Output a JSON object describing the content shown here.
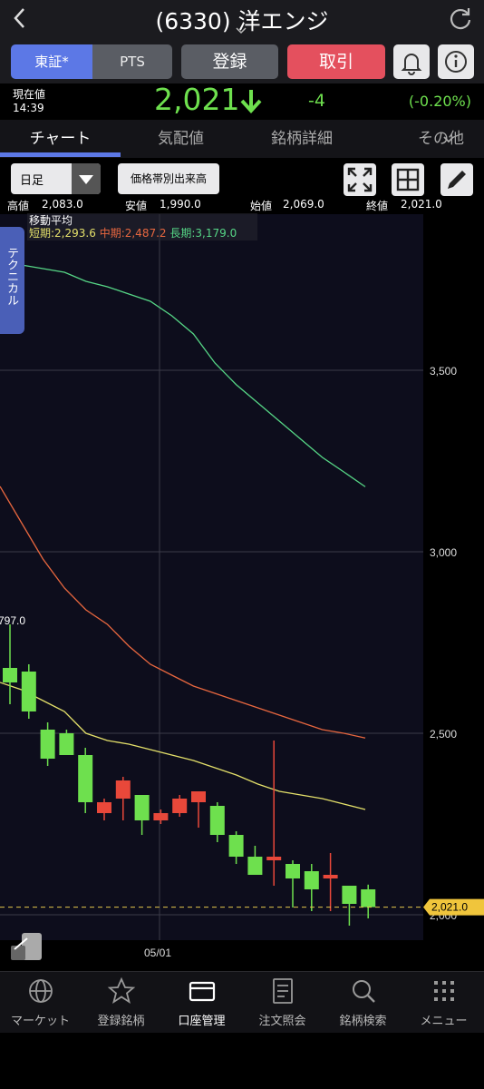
{
  "header": {
    "title": "(6330) 洋エンジ"
  },
  "buttons": {
    "tse": "東証*",
    "pts": "PTS",
    "register": "登録",
    "trade": "取引"
  },
  "price": {
    "label": "現在値",
    "time": "14:39",
    "value": "2,021",
    "change": "-4",
    "change_pct": "(-0.20%)"
  },
  "tabs": [
    {
      "label": "チャート"
    },
    {
      "label": "気配値"
    },
    {
      "label": "銘柄詳細"
    },
    {
      "label": "その他"
    }
  ],
  "toolbar": {
    "period": "日足",
    "volume_profile": "価格帯別出来高"
  },
  "ohlc": {
    "high_label": "高値",
    "high": "2,083.0",
    "low_label": "安値",
    "low": "1,990.0",
    "open_label": "始値",
    "open": "2,069.0",
    "close_label": "終値",
    "close": "2,021.0"
  },
  "moving_average": {
    "title": "移動平均",
    "short_label": "短期:2,293.6",
    "mid_label": "中期:2,487.2",
    "long_label": "長期:3,179.0",
    "colors": {
      "short": "#e4e06a",
      "mid": "#e8673f",
      "long": "#56d686"
    }
  },
  "technical_tab": "テクニカル",
  "chart_data": {
    "type": "candlestick",
    "y_ticks": [
      "3,500",
      "3,000",
      "2,500",
      "2,000"
    ],
    "ylim": [
      1930,
      3930
    ],
    "x_ticks": [
      "05/01"
    ],
    "visible_high_label": "797.0",
    "last_price_label": "2,021.0",
    "last_price": 2021,
    "candles": [
      {
        "o": 2680,
        "h": 2800,
        "l": 2580,
        "c": 2640
      },
      {
        "o": 2670,
        "h": 2690,
        "l": 2540,
        "c": 2560
      },
      {
        "o": 2510,
        "h": 2530,
        "l": 2410,
        "c": 2430
      },
      {
        "o": 2500,
        "h": 2510,
        "l": 2440,
        "c": 2440
      },
      {
        "o": 2440,
        "h": 2460,
        "l": 2280,
        "c": 2310
      },
      {
        "o": 2280,
        "h": 2320,
        "l": 2260,
        "c": 2310
      },
      {
        "o": 2320,
        "h": 2380,
        "l": 2260,
        "c": 2370
      },
      {
        "o": 2330,
        "h": 2330,
        "l": 2220,
        "c": 2260
      },
      {
        "o": 2260,
        "h": 2290,
        "l": 2250,
        "c": 2280
      },
      {
        "o": 2280,
        "h": 2330,
        "l": 2270,
        "c": 2320
      },
      {
        "o": 2310,
        "h": 2340,
        "l": 2240,
        "c": 2340
      },
      {
        "o": 2300,
        "h": 2310,
        "l": 2200,
        "c": 2220
      },
      {
        "o": 2220,
        "h": 2230,
        "l": 2140,
        "c": 2160
      },
      {
        "o": 2160,
        "h": 2190,
        "l": 2110,
        "c": 2110
      },
      {
        "o": 2150,
        "h": 2480,
        "l": 2080,
        "c": 2160
      },
      {
        "o": 2140,
        "h": 2150,
        "l": 2020,
        "c": 2100
      },
      {
        "o": 2120,
        "h": 2140,
        "l": 2010,
        "c": 2070
      },
      {
        "o": 2100,
        "h": 2170,
        "l": 2010,
        "c": 2110
      },
      {
        "o": 2080,
        "h": 2080,
        "l": 1970,
        "c": 2030
      },
      {
        "o": 2070,
        "h": 2083,
        "l": 1990,
        "c": 2021
      }
    ],
    "ma_short": [
      2640,
      2620,
      2590,
      2560,
      2500,
      2480,
      2470,
      2455,
      2440,
      2425,
      2405,
      2385,
      2360,
      2340,
      2330,
      2320,
      2305,
      2290
    ],
    "ma_mid": [
      3180,
      3080,
      2980,
      2900,
      2840,
      2800,
      2740,
      2690,
      2660,
      2630,
      2610,
      2590,
      2570,
      2550,
      2530,
      2510,
      2500,
      2487
    ],
    "ma_long": [
      3800,
      3790,
      3780,
      3770,
      3745,
      3730,
      3710,
      3690,
      3650,
      3600,
      3520,
      3460,
      3410,
      3360,
      3310,
      3260,
      3220,
      3179
    ]
  },
  "bottom_nav": [
    {
      "label": "マーケット",
      "icon": "globe-icon"
    },
    {
      "label": "登録銘柄",
      "icon": "star-icon"
    },
    {
      "label": "口座管理",
      "icon": "card-icon"
    },
    {
      "label": "注文照会",
      "icon": "document-icon"
    },
    {
      "label": "銘柄検索",
      "icon": "search-icon"
    },
    {
      "label": "メニュー",
      "icon": "menu-grid-icon"
    }
  ]
}
